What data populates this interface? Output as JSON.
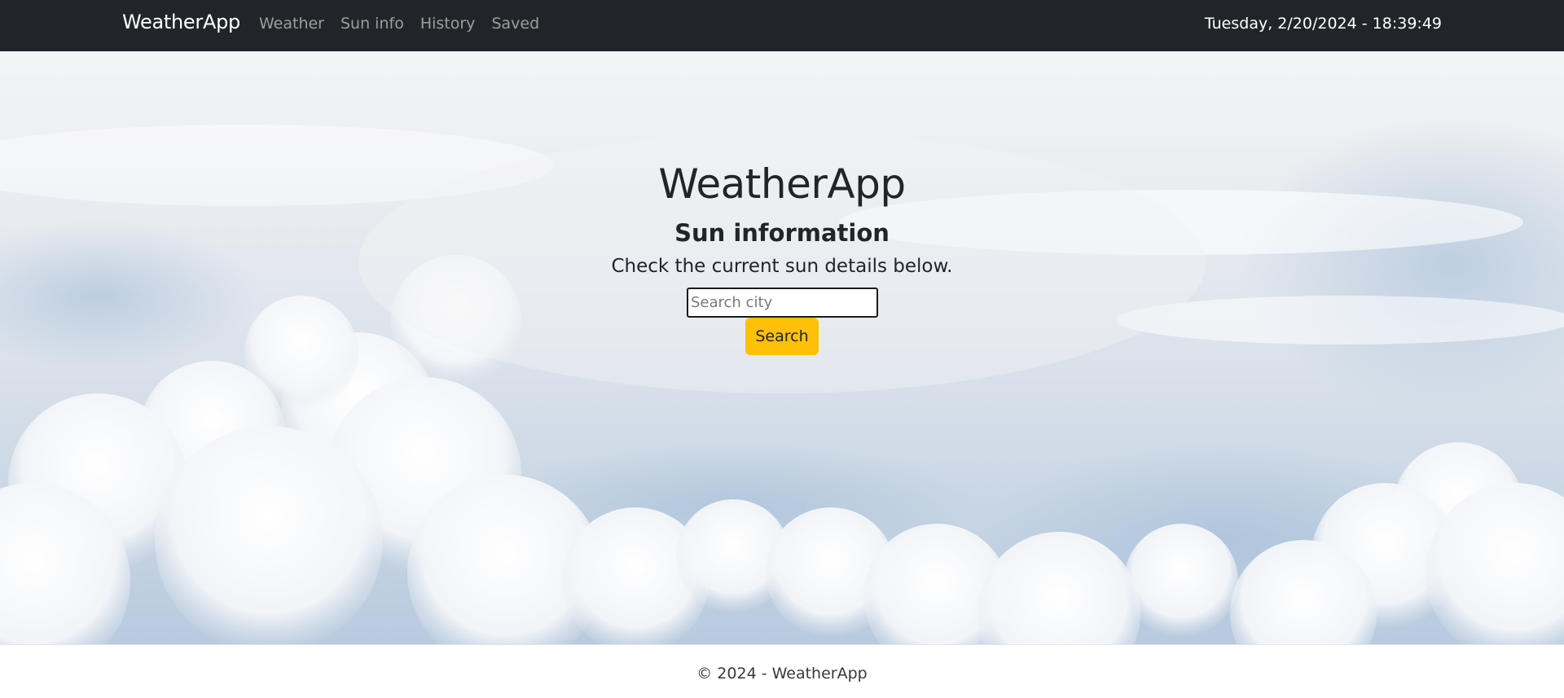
{
  "navbar": {
    "brand": "WeatherApp",
    "links": [
      {
        "label": "Weather"
      },
      {
        "label": "Sun info"
      },
      {
        "label": "History"
      },
      {
        "label": "Saved"
      }
    ],
    "clock": "Tuesday, 2/20/2024 - 18:39:49"
  },
  "hero": {
    "title": "WeatherApp",
    "subtitle": "Sun information",
    "text": "Check the current sun details below.",
    "search": {
      "placeholder": "Search city",
      "value": "",
      "button_label": "Search"
    },
    "background": "sky-with-clouds"
  },
  "footer": {
    "text": "© 2024 - WeatherApp"
  },
  "colors": {
    "navbar_bg": "#212529",
    "accent": "#ffc107",
    "text": "#212529"
  }
}
